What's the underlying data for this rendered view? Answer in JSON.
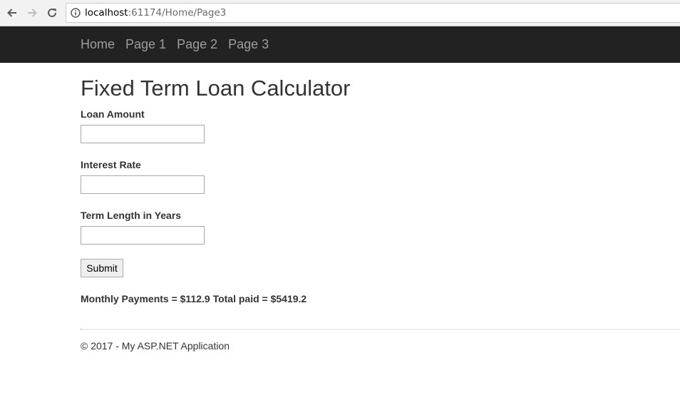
{
  "browser": {
    "url_host": "localhost",
    "url_path": ":61174/Home/Page3"
  },
  "navbar": {
    "links": [
      "Home",
      "Page 1",
      "Page 2",
      "Page 3"
    ]
  },
  "page": {
    "title": "Fixed Term Loan Calculator"
  },
  "form": {
    "loan_amount_label": "Loan Amount",
    "loan_amount_value": "",
    "interest_rate_label": "Interest Rate",
    "interest_rate_value": "",
    "term_length_label": "Term Length in Years",
    "term_length_value": "",
    "submit_label": "Submit"
  },
  "result": {
    "text": "Monthly Payments = $112.9 Total paid = $5419.2"
  },
  "footer": {
    "text": "© 2017 - My ASP.NET Application"
  },
  "colors": {
    "navbar_bg": "#222222",
    "nav_link": "#9d9d9d",
    "text": "#333333"
  }
}
